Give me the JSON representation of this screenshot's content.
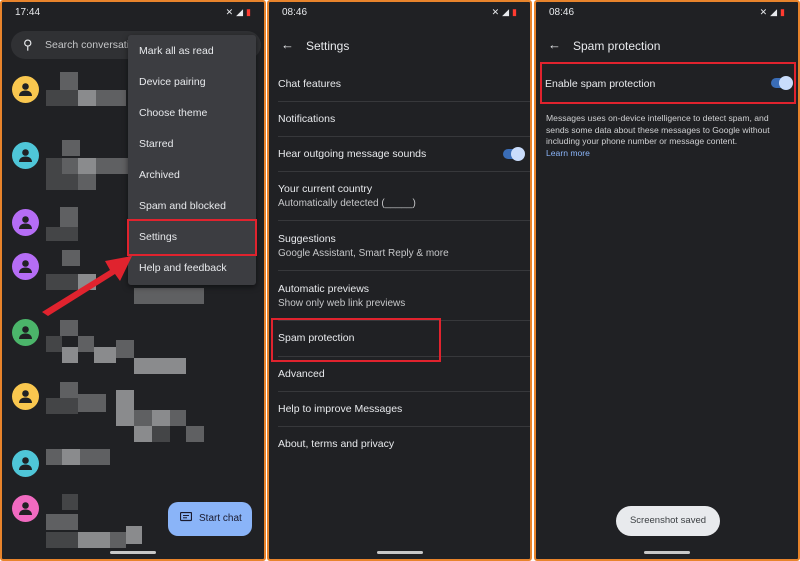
{
  "panel1": {
    "status": {
      "time": "17:44"
    },
    "search": {
      "placeholder": "Search conversati"
    },
    "menu": [
      "Mark all as read",
      "Device pairing",
      "Choose theme",
      "Starred",
      "Archived",
      "Spam and blocked",
      "Settings",
      "Help and feedback"
    ],
    "fab": {
      "label": "Start chat"
    },
    "avatar_colors": [
      "#f9c74f",
      "#4fc6d8",
      "#b56df5",
      "#b56df5",
      "#4bb56a",
      "#f9c74f",
      "#4fc6d8",
      "#f06ac0"
    ],
    "highlight_color": "#e0232e"
  },
  "panel2": {
    "status": {
      "time": "08:46"
    },
    "title": "Settings",
    "items": [
      {
        "title": "Chat features"
      },
      {
        "title": "Notifications"
      },
      {
        "title": "Hear outgoing message sounds",
        "toggle": "on"
      },
      {
        "title": "Your current country",
        "subtitle": "Automatically detected (_____)"
      },
      {
        "title": "Suggestions",
        "subtitle": "Google Assistant, Smart Reply & more"
      },
      {
        "title": "Automatic previews",
        "subtitle": "Show only web link previews"
      },
      {
        "title": "Spam protection"
      },
      {
        "title": "Advanced"
      },
      {
        "title": "Help to improve Messages"
      },
      {
        "title": "About, terms and privacy"
      }
    ]
  },
  "panel3": {
    "status": {
      "time": "08:46"
    },
    "title": "Spam protection",
    "enable_label": "Enable spam protection",
    "toggle": "on",
    "description": "Messages uses on-device intelligence to detect spam, and sends some data about these messages to Google without including your phone number or message content.",
    "learn_more": "Learn more",
    "toast": "Screenshot saved"
  },
  "colors": {
    "background": "#202124",
    "accent": "#8ab4f8",
    "toggle_on": "#3a6db7",
    "frame": "#e8842c"
  }
}
